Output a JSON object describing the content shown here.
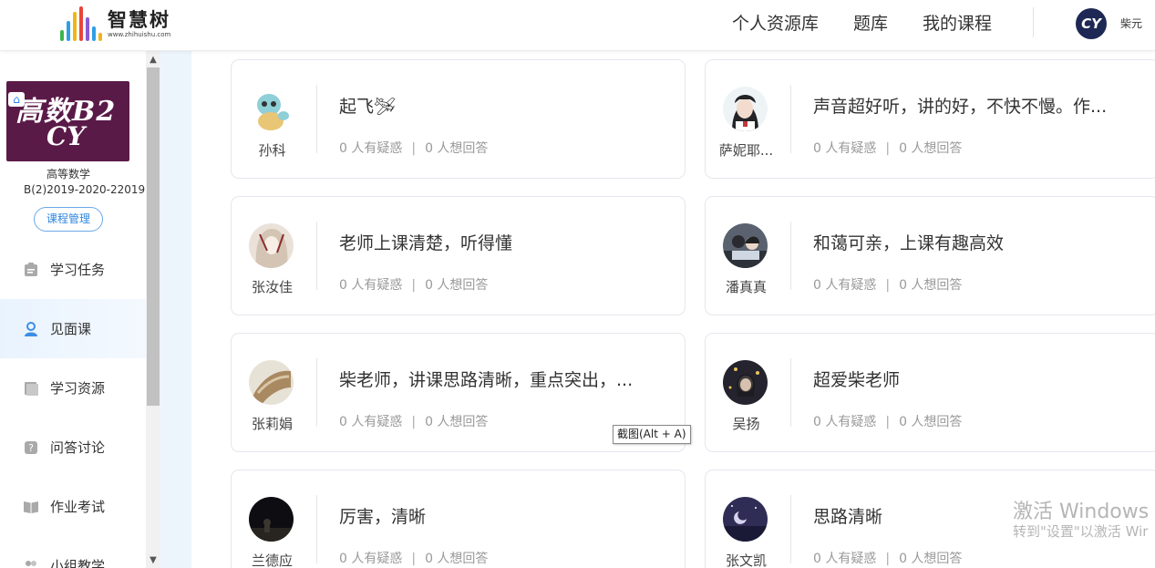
{
  "header": {
    "logo_name": "智慧树",
    "logo_url": "www.zhihuishu.com",
    "nav": [
      "个人资源库",
      "题库",
      "我的课程"
    ],
    "avatar_initials": "CY",
    "user_name": "柴元"
  },
  "sidebar": {
    "cover_line1": "高数B2",
    "cover_line2": "CY",
    "course_name": "高等数学",
    "course_code": "B(2)2019-2020-22019",
    "manage_label": "课程管理",
    "menu": [
      {
        "label": "学习任务",
        "icon": "task-icon"
      },
      {
        "label": "见面课",
        "icon": "person-icon",
        "active": true
      },
      {
        "label": "学习资源",
        "icon": "resource-icon"
      },
      {
        "label": "问答讨论",
        "icon": "qa-icon"
      },
      {
        "label": "作业考试",
        "icon": "book-icon"
      },
      {
        "label": "小组教学",
        "icon": "group-icon"
      }
    ]
  },
  "cards": [
    {
      "name": "孙科",
      "title": "起飞🛩",
      "doubt": "0 人有疑惑",
      "answer": "0 人想回答",
      "avatar_color": "#8ecfd8"
    },
    {
      "name": "萨妮耶...",
      "title": "声音超好听，讲的好，不快不慢。作...",
      "doubt": "0 人有疑惑",
      "answer": "0 人想回答",
      "avatar_color": "#3c3c44"
    },
    {
      "name": "张汝佳",
      "title": "老师上课清楚，听得懂",
      "doubt": "0 人有疑惑",
      "answer": "0 人想回答",
      "avatar_color": "#c9b7a8"
    },
    {
      "name": "潘真真",
      "title": "和蔼可亲，上课有趣高效",
      "doubt": "0 人有疑惑",
      "answer": "0 人想回答",
      "avatar_color": "#4d5563"
    },
    {
      "name": "张莉娟",
      "title": "柴老师，讲课思路清晰，重点突出，...",
      "doubt": "0 人有疑惑",
      "answer": "0 人想回答",
      "avatar_color": "#b39a74"
    },
    {
      "name": "吴扬",
      "title": "超爱柴老师",
      "doubt": "0 人有疑惑",
      "answer": "0 人想回答",
      "avatar_color": "#2d2b36"
    },
    {
      "name": "兰德应",
      "title": "厉害，清晰",
      "doubt": "0 人有疑惑",
      "answer": "0 人想回答",
      "avatar_color": "#141418"
    },
    {
      "name": "张文凯",
      "title": "思路清晰",
      "doubt": "0 人有疑惑",
      "answer": "0 人想回答",
      "avatar_color": "#3f3d64"
    }
  ],
  "tooltip": "截图(Alt + A)",
  "watermark": {
    "line1": "激活 Windows",
    "line2": "转到\"设置\"以激活 Wir"
  }
}
